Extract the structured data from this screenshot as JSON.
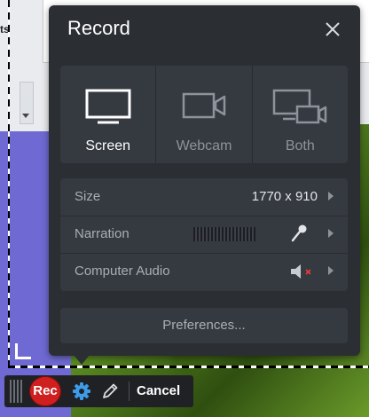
{
  "background": {
    "text_fragment": "ts"
  },
  "panel": {
    "title": "Record",
    "modes": [
      {
        "label": "Screen",
        "icon": "monitor-icon",
        "active": true
      },
      {
        "label": "Webcam",
        "icon": "webcam-icon",
        "active": false
      },
      {
        "label": "Both",
        "icon": "monitor-webcam-icon",
        "active": false
      }
    ],
    "settings": {
      "size": {
        "label": "Size",
        "value": "1770 x 910"
      },
      "narration": {
        "label": "Narration",
        "icon": "microphone-icon"
      },
      "computer_audio": {
        "label": "Computer Audio",
        "icon": "speaker-muted-icon"
      }
    },
    "preferences_label": "Preferences..."
  },
  "toolbar": {
    "rec_label": "Rec",
    "cancel_label": "Cancel"
  },
  "colors": {
    "panel_bg": "#2b2e33",
    "group_bg": "#353940",
    "rec_red": "#d01f1f",
    "gear_blue": "#3d9be9",
    "mute_red": "#e23b3b"
  }
}
